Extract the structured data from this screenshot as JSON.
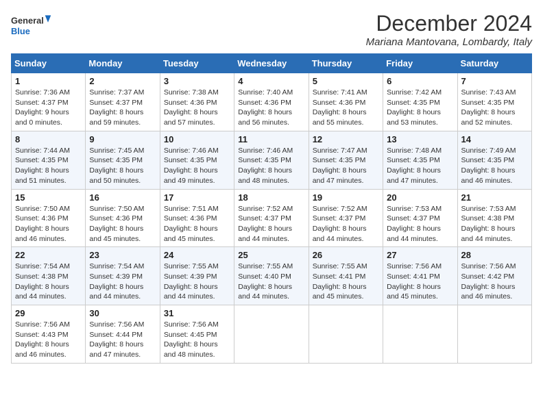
{
  "header": {
    "logo_line1": "General",
    "logo_line2": "Blue",
    "month_year": "December 2024",
    "location": "Mariana Mantovana, Lombardy, Italy"
  },
  "days_of_week": [
    "Sunday",
    "Monday",
    "Tuesday",
    "Wednesday",
    "Thursday",
    "Friday",
    "Saturday"
  ],
  "weeks": [
    [
      {
        "day": "1",
        "info": "Sunrise: 7:36 AM\nSunset: 4:37 PM\nDaylight: 9 hours\nand 0 minutes."
      },
      {
        "day": "2",
        "info": "Sunrise: 7:37 AM\nSunset: 4:37 PM\nDaylight: 8 hours\nand 59 minutes."
      },
      {
        "day": "3",
        "info": "Sunrise: 7:38 AM\nSunset: 4:36 PM\nDaylight: 8 hours\nand 57 minutes."
      },
      {
        "day": "4",
        "info": "Sunrise: 7:40 AM\nSunset: 4:36 PM\nDaylight: 8 hours\nand 56 minutes."
      },
      {
        "day": "5",
        "info": "Sunrise: 7:41 AM\nSunset: 4:36 PM\nDaylight: 8 hours\nand 55 minutes."
      },
      {
        "day": "6",
        "info": "Sunrise: 7:42 AM\nSunset: 4:35 PM\nDaylight: 8 hours\nand 53 minutes."
      },
      {
        "day": "7",
        "info": "Sunrise: 7:43 AM\nSunset: 4:35 PM\nDaylight: 8 hours\nand 52 minutes."
      }
    ],
    [
      {
        "day": "8",
        "info": "Sunrise: 7:44 AM\nSunset: 4:35 PM\nDaylight: 8 hours\nand 51 minutes."
      },
      {
        "day": "9",
        "info": "Sunrise: 7:45 AM\nSunset: 4:35 PM\nDaylight: 8 hours\nand 50 minutes."
      },
      {
        "day": "10",
        "info": "Sunrise: 7:46 AM\nSunset: 4:35 PM\nDaylight: 8 hours\nand 49 minutes."
      },
      {
        "day": "11",
        "info": "Sunrise: 7:46 AM\nSunset: 4:35 PM\nDaylight: 8 hours\nand 48 minutes."
      },
      {
        "day": "12",
        "info": "Sunrise: 7:47 AM\nSunset: 4:35 PM\nDaylight: 8 hours\nand 47 minutes."
      },
      {
        "day": "13",
        "info": "Sunrise: 7:48 AM\nSunset: 4:35 PM\nDaylight: 8 hours\nand 47 minutes."
      },
      {
        "day": "14",
        "info": "Sunrise: 7:49 AM\nSunset: 4:35 PM\nDaylight: 8 hours\nand 46 minutes."
      }
    ],
    [
      {
        "day": "15",
        "info": "Sunrise: 7:50 AM\nSunset: 4:36 PM\nDaylight: 8 hours\nand 46 minutes."
      },
      {
        "day": "16",
        "info": "Sunrise: 7:50 AM\nSunset: 4:36 PM\nDaylight: 8 hours\nand 45 minutes."
      },
      {
        "day": "17",
        "info": "Sunrise: 7:51 AM\nSunset: 4:36 PM\nDaylight: 8 hours\nand 45 minutes."
      },
      {
        "day": "18",
        "info": "Sunrise: 7:52 AM\nSunset: 4:37 PM\nDaylight: 8 hours\nand 44 minutes."
      },
      {
        "day": "19",
        "info": "Sunrise: 7:52 AM\nSunset: 4:37 PM\nDaylight: 8 hours\nand 44 minutes."
      },
      {
        "day": "20",
        "info": "Sunrise: 7:53 AM\nSunset: 4:37 PM\nDaylight: 8 hours\nand 44 minutes."
      },
      {
        "day": "21",
        "info": "Sunrise: 7:53 AM\nSunset: 4:38 PM\nDaylight: 8 hours\nand 44 minutes."
      }
    ],
    [
      {
        "day": "22",
        "info": "Sunrise: 7:54 AM\nSunset: 4:38 PM\nDaylight: 8 hours\nand 44 minutes."
      },
      {
        "day": "23",
        "info": "Sunrise: 7:54 AM\nSunset: 4:39 PM\nDaylight: 8 hours\nand 44 minutes."
      },
      {
        "day": "24",
        "info": "Sunrise: 7:55 AM\nSunset: 4:39 PM\nDaylight: 8 hours\nand 44 minutes."
      },
      {
        "day": "25",
        "info": "Sunrise: 7:55 AM\nSunset: 4:40 PM\nDaylight: 8 hours\nand 44 minutes."
      },
      {
        "day": "26",
        "info": "Sunrise: 7:55 AM\nSunset: 4:41 PM\nDaylight: 8 hours\nand 45 minutes."
      },
      {
        "day": "27",
        "info": "Sunrise: 7:56 AM\nSunset: 4:41 PM\nDaylight: 8 hours\nand 45 minutes."
      },
      {
        "day": "28",
        "info": "Sunrise: 7:56 AM\nSunset: 4:42 PM\nDaylight: 8 hours\nand 46 minutes."
      }
    ],
    [
      {
        "day": "29",
        "info": "Sunrise: 7:56 AM\nSunset: 4:43 PM\nDaylight: 8 hours\nand 46 minutes."
      },
      {
        "day": "30",
        "info": "Sunrise: 7:56 AM\nSunset: 4:44 PM\nDaylight: 8 hours\nand 47 minutes."
      },
      {
        "day": "31",
        "info": "Sunrise: 7:56 AM\nSunset: 4:45 PM\nDaylight: 8 hours\nand 48 minutes."
      },
      null,
      null,
      null,
      null
    ]
  ]
}
